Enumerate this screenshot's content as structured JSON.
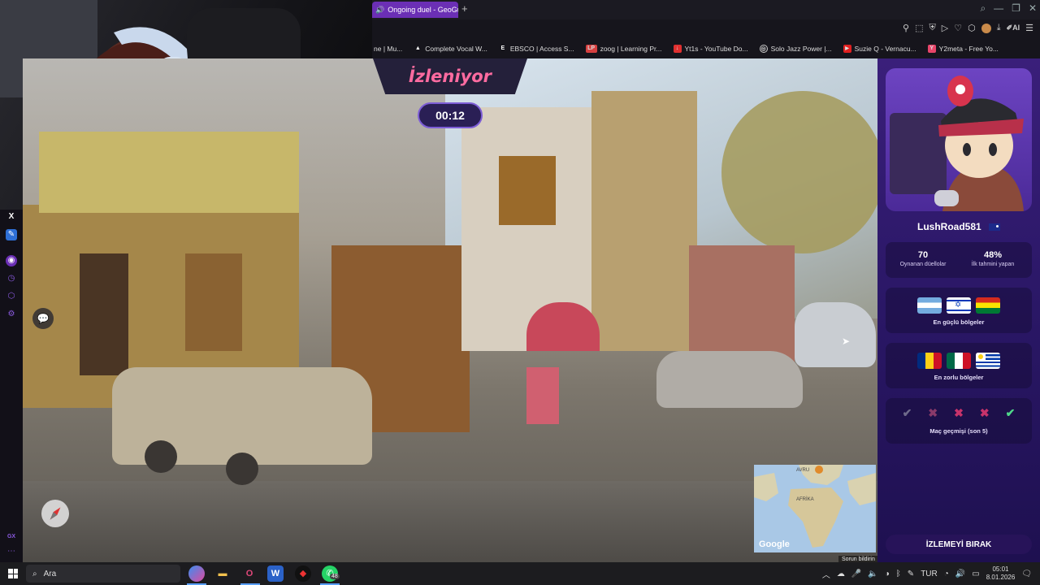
{
  "browser": {
    "tab_title": "Ongoing duel - GeoGu",
    "new_tab": "+",
    "ai_label": "AI",
    "bookmarks": [
      {
        "label": "ne | Mu...",
        "icon": ""
      },
      {
        "label": "Complete Vocal W...",
        "icon": "A"
      },
      {
        "label": "EBSCO | Access S...",
        "icon": "E"
      },
      {
        "label": "zoog | Learning Pr...",
        "icon": "LP"
      },
      {
        "label": "Yt1s - YouTube Do...",
        "icon": "Y"
      },
      {
        "label": "Solo Jazz Power |...",
        "icon": "S"
      },
      {
        "label": "Suzie Q - Vernacu...",
        "icon": "▶"
      },
      {
        "label": "Y2meta - Free Yo...",
        "icon": "Y"
      }
    ]
  },
  "game": {
    "status_banner": "İzleniyor",
    "timer": "00:12",
    "report_link": "Sorun bildirin",
    "map_labels": {
      "europe": "AVRU",
      "africa": "AFRİKA",
      "brand": "Google"
    }
  },
  "player": {
    "name": "LushRoad581",
    "stats": [
      {
        "value": "70",
        "label": "Oynanan düellolar"
      },
      {
        "value": "48%",
        "label": "İlk tahmini yapan"
      }
    ],
    "strongest_label": "En güçlü bölgeler",
    "strongest_flags": [
      "argentina-flag",
      "israel-flag",
      "bolivia-flag"
    ],
    "weakest_label": "En zorlu bölgeler",
    "weakest_flags": [
      "romania-flag",
      "mexico-flag",
      "uruguay-flag"
    ],
    "history_label": "Maç geçmişi (son 5)",
    "history": [
      "✔",
      "✖",
      "✖",
      "✖",
      "✔"
    ],
    "history_colors": [
      "#6f6a8a",
      "#8a3a6a",
      "#c8336b",
      "#c8336b",
      "#4fd98a"
    ],
    "stop_button": "İZLEMEYİ BIRAK"
  },
  "taskbar": {
    "search_placeholder": "Ara",
    "whatsapp_badge": "48",
    "language": "TUR",
    "time": "05:01",
    "date": "8.01.2026"
  },
  "colors": {
    "accent_pink": "#ff6ba0",
    "panel_purple": "#2a1766",
    "tab_purple": "#6b2fb5"
  }
}
